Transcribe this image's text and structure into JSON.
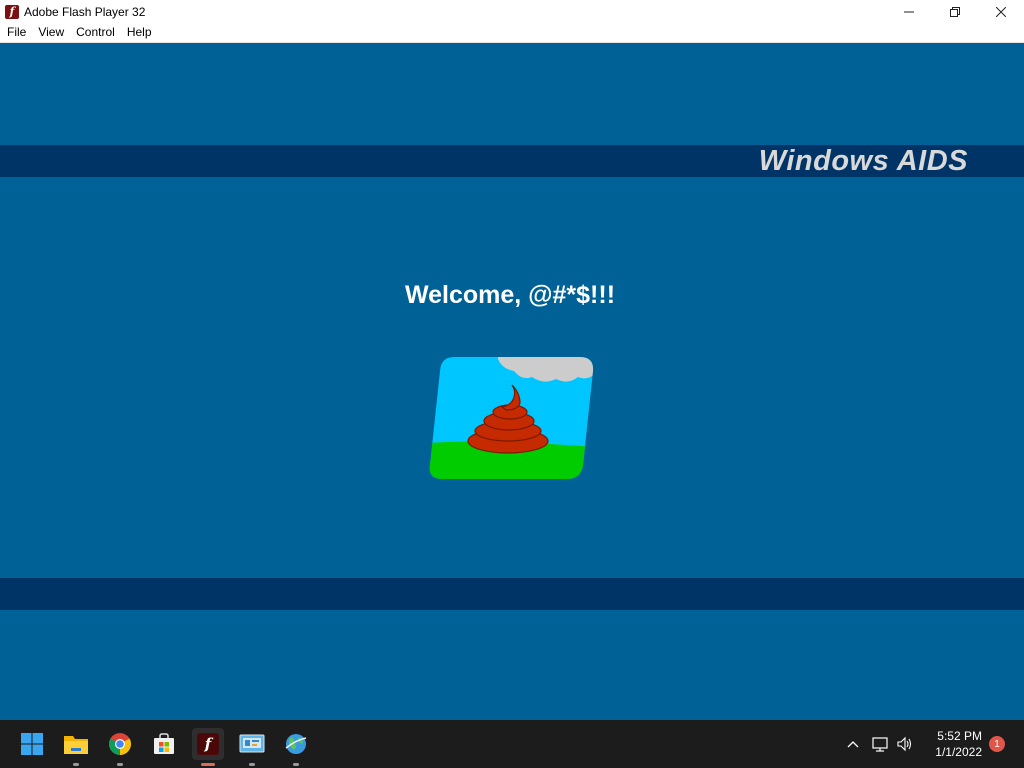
{
  "window": {
    "title": "Adobe Flash Player 32",
    "app_icon": "flash-player-icon",
    "controls": {
      "minimize": "—",
      "maximize": "❐",
      "close": "✕"
    }
  },
  "menu": [
    "File",
    "View",
    "Control",
    "Help"
  ],
  "stage": {
    "brand": "Windows AIDS",
    "welcome": "Welcome, @#*$!!!",
    "logo": "poop-logo-icon",
    "colors": {
      "background": "#006196",
      "band": "#003466",
      "brand_text": "#d9d9d9"
    }
  },
  "taskbar": {
    "apps": [
      {
        "name": "start-icon"
      },
      {
        "name": "file-explorer-icon"
      },
      {
        "name": "chrome-icon"
      },
      {
        "name": "microsoft-store-icon"
      },
      {
        "name": "flash-player-icon",
        "active": true
      },
      {
        "name": "control-panel-icon"
      },
      {
        "name": "internet-globe-icon"
      }
    ],
    "tray_icons": [
      "chevron-up-icon",
      "network-icon",
      "volume-icon"
    ],
    "time": "5:52 PM",
    "date": "1/1/2022",
    "notification_count": "1"
  }
}
